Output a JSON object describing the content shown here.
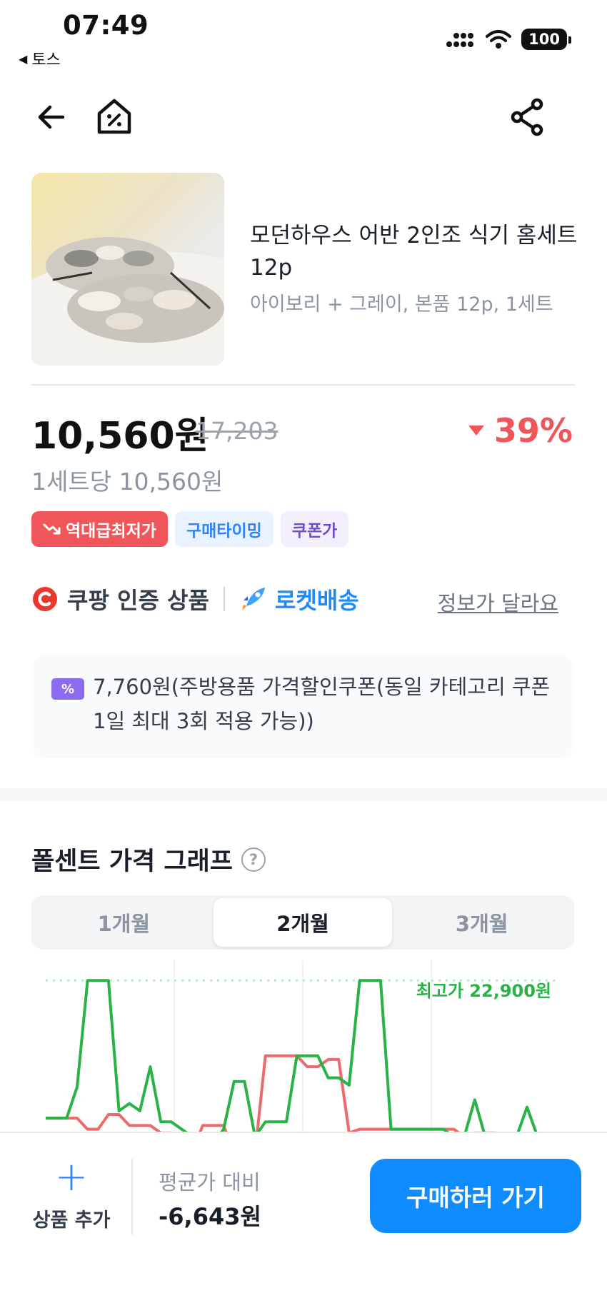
{
  "status": {
    "time": "07:49",
    "back_app": "토스",
    "battery": "100"
  },
  "product": {
    "title": "모던하우스 어반 2인조 식기 홈세트 12p",
    "option": "아이보리 + 그레이, 본품 12p, 1세트"
  },
  "price": {
    "current": "10,560원",
    "original": "17,203",
    "discount": "39%",
    "unit": "1세트당 10,560원"
  },
  "badges": {
    "lowest": "역대급최저가",
    "timing": "구매타이밍",
    "coupon": "쿠폰가"
  },
  "cert": {
    "coupang": "쿠팡 인증 상품",
    "rocket": "로켓배송",
    "info_link": "정보가 달라요"
  },
  "coupon_text": "7,760원(주방용품 가격할인쿠폰(동일 카테고리 쿠폰 1일 최대 3회 적용 가능))",
  "graph": {
    "title": "폴센트 가격 그래프",
    "tabs": [
      "1개월",
      "2개월",
      "3개월"
    ],
    "active_tab": "2개월",
    "max_label": "최고가 22,900원"
  },
  "chart_data": {
    "type": "line",
    "title": "",
    "series": [
      {
        "color": "#27b346",
        "values": [
          15400,
          15400,
          15400,
          17100,
          22900,
          22900,
          22900,
          15800,
          16200,
          15800,
          18200,
          15200,
          15200,
          14800,
          14400,
          14400,
          14000,
          14800,
          17400,
          17400,
          14400,
          15200,
          15200,
          15200,
          18800,
          18800,
          18800,
          17600,
          17600,
          17200,
          22900,
          22900,
          22900,
          14800,
          14800,
          14800,
          14800,
          14800,
          14800,
          14400,
          14400,
          16400,
          14400,
          14400,
          14400,
          14400,
          16000,
          14400,
          14400,
          13700
        ]
      },
      {
        "color": "#ee6a6a",
        "values": [
          15400,
          15400,
          15400,
          15400,
          14800,
          14800,
          15600,
          15600,
          15000,
          15000,
          15000,
          14600,
          14600,
          13500,
          13500,
          15000,
          15000,
          15000,
          13500,
          13500,
          13500,
          18800,
          18800,
          18800,
          18800,
          18200,
          18200,
          18600,
          18600,
          14600,
          14800,
          14800,
          14800,
          14800,
          14800,
          14800,
          14800,
          14800,
          14800,
          14800,
          14400,
          14600,
          14600,
          14600,
          14000,
          13500,
          13500,
          13500,
          13500,
          13500
        ]
      }
    ],
    "max_label_value": 22900,
    "ylim": [
      13500,
      24000
    ],
    "grid": true
  },
  "bottom": {
    "add_label": "상품 추가",
    "avg_label": "평균가 대비",
    "avg_value": "-6,643원",
    "buy_label": "구매하러 가기"
  }
}
